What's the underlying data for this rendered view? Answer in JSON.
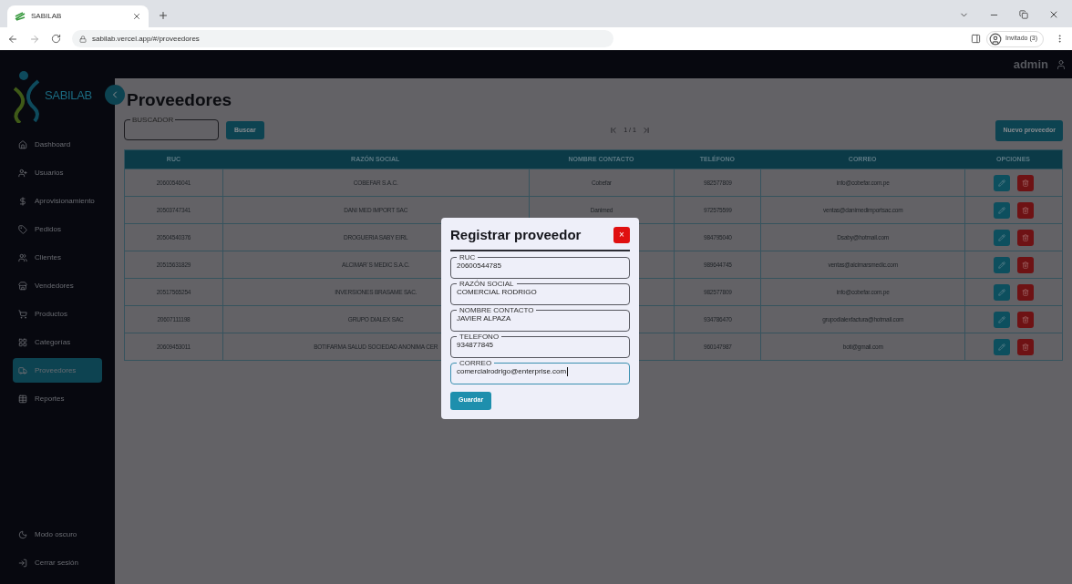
{
  "browser": {
    "tab_title": "SABILAB",
    "url": "sabilab.vercel.app/#/proveedores",
    "profile": "Invitado (3)"
  },
  "header": {
    "user": "admin"
  },
  "logo": {
    "text": "SABILAB"
  },
  "sidebar": {
    "items": [
      {
        "label": "Dashboard",
        "selected": false
      },
      {
        "label": "Usuarios",
        "selected": false
      },
      {
        "label": "Aprovisionamiento",
        "selected": false
      },
      {
        "label": "Pedidos",
        "selected": false
      },
      {
        "label": "Clientes",
        "selected": false
      },
      {
        "label": "Vendedores",
        "selected": false
      },
      {
        "label": "Productos",
        "selected": false
      },
      {
        "label": "Categorías",
        "selected": false
      },
      {
        "label": "Proveedores",
        "selected": true
      },
      {
        "label": "Reportes",
        "selected": false
      }
    ],
    "bottom": [
      "Modo oscuro",
      "Cerrar sesión"
    ]
  },
  "page": {
    "title": "Proveedores",
    "search": {
      "label": "BUSCADOR"
    },
    "search_button": "Buscar",
    "pagination": "1 / 1",
    "new_button": "Nuevo proveedor"
  },
  "table": {
    "columns": [
      "RUC",
      "RAZÓN SOCIAL",
      "NOMBRE CONTACTO",
      "TELÉFONO",
      "CORREO",
      "OPCIONES"
    ],
    "rows": [
      {
        "ruc": "20600546041",
        "razon": "COBEFAR S.A.C.",
        "contacto": "Cobefar",
        "telefono": "982577809",
        "correo": "info@cobefar.com.pe"
      },
      {
        "ruc": "20503747341",
        "razon": "DANI MED IMPORT SAC",
        "contacto": "Danimed",
        "telefono": "972575599",
        "correo": "ventas@danimedimportsac.com"
      },
      {
        "ruc": "20504540376",
        "razon": "DROGUERIA SABY EIRL",
        "telefono": "984795040",
        "correo": "Dsaby@hotmail.com"
      },
      {
        "ruc": "20515631829",
        "razon": "ALCIMAR´S MEDIC S.A.C.",
        "telefono": "989644745",
        "correo": "ventas@alcimarsmedic.com"
      },
      {
        "ruc": "20517565254",
        "razon": "INVERSIONES BRASAME SAC.",
        "telefono": "982577809",
        "correo": "info@cobefar.com.pe"
      },
      {
        "ruc": "20607111198",
        "razon": "GRUPO DIALEX SAC",
        "telefono": "934786470",
        "correo": "grupodialexfactura@hotmail.com"
      },
      {
        "ruc": "20609453011",
        "razon": "BOTIFARMA SALUD SOCIEDAD ANONIMA CER",
        "telefono": "960147987",
        "correo": "boti@gmail.com"
      }
    ]
  },
  "modal": {
    "title": "Registrar proveedor",
    "close": "×",
    "fields": [
      {
        "label": "RUC",
        "value": "20600544785",
        "focused": false
      },
      {
        "label": "RAZÓN SOCIAL",
        "value": "COMERCIAL RODRIGO",
        "focused": false
      },
      {
        "label": "NOMBRE CONTACTO",
        "value": "JAVIER ALPAZA",
        "focused": false
      },
      {
        "label": "TELEFONO",
        "value": "934877845",
        "focused": false
      },
      {
        "label": "CORREO",
        "value": "comercialrodrigo@enterprise.com",
        "focused": true
      }
    ],
    "save_button": "Guardar"
  }
}
